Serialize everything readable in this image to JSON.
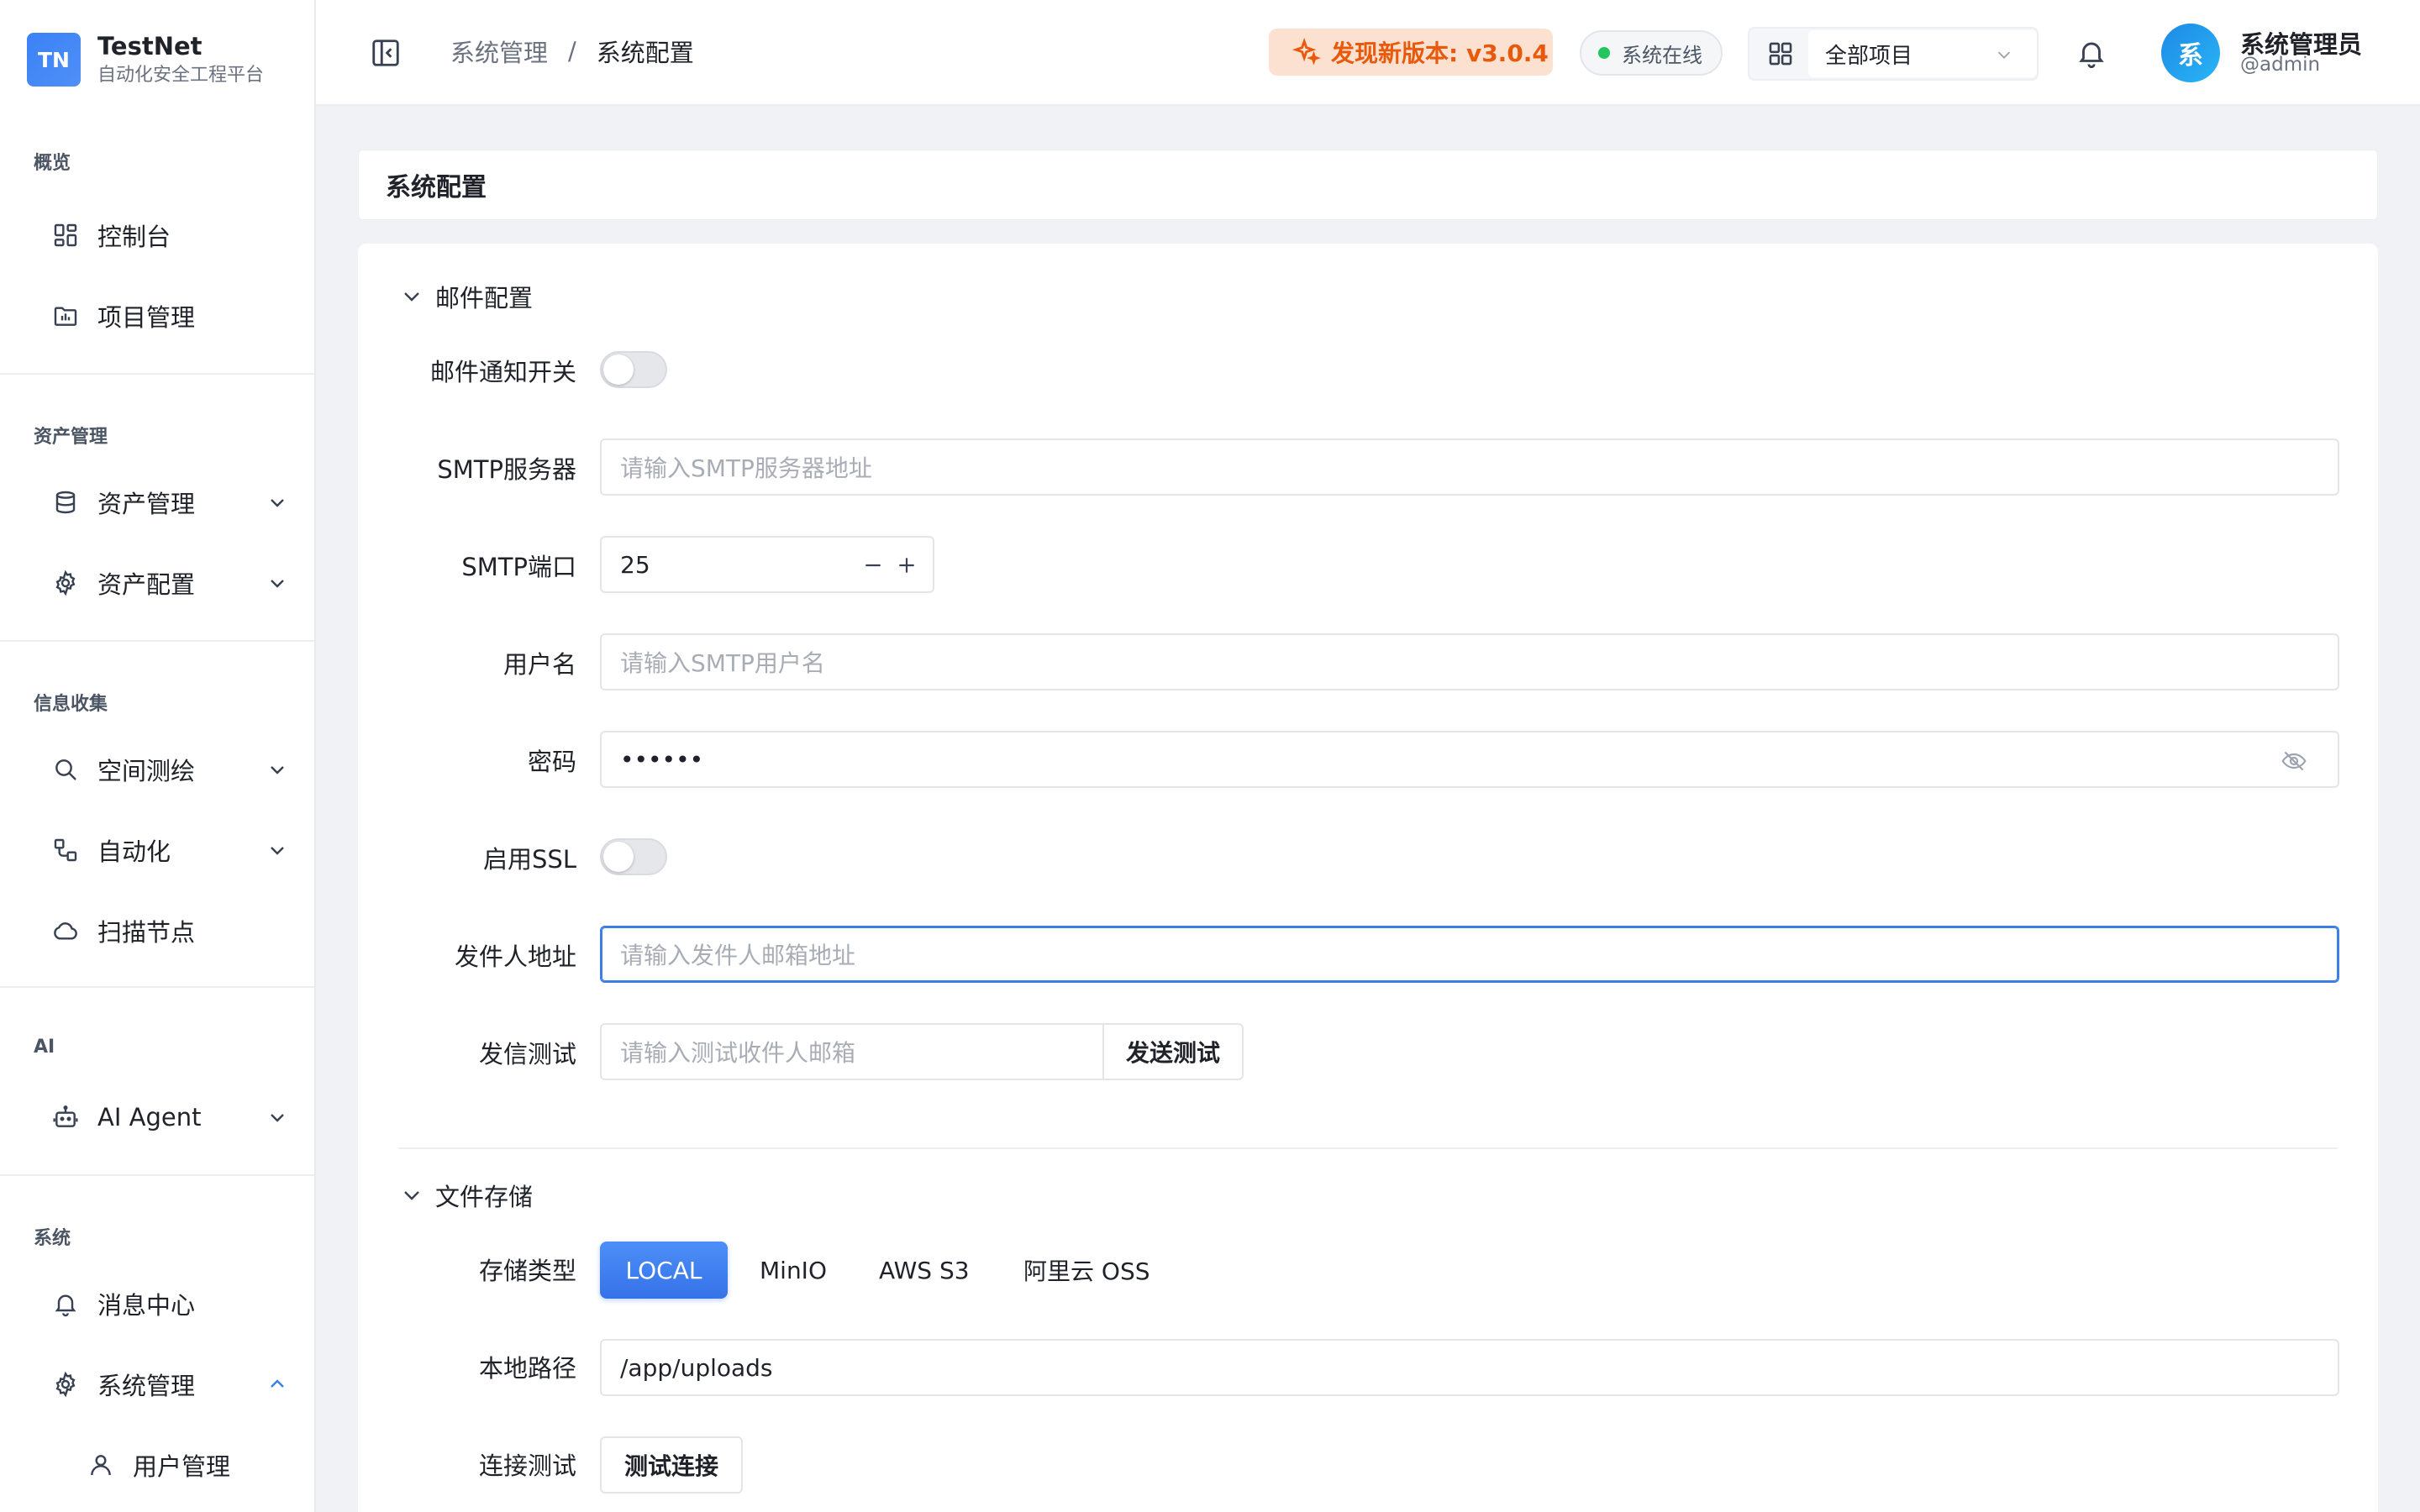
{
  "brand": {
    "logo": "TN",
    "name": "TestNet",
    "subtitle": "自动化安全工程平台"
  },
  "sidebar": {
    "sections": [
      {
        "title": "概览"
      },
      {
        "title": "资产管理"
      },
      {
        "title": "信息收集"
      },
      {
        "title": "AI"
      },
      {
        "title": "系统"
      }
    ],
    "items": [
      {
        "label": "控制台",
        "icon": "dashboard-icon"
      },
      {
        "label": "项目管理",
        "icon": "folder-chart-icon"
      },
      {
        "label": "资产管理",
        "icon": "database-icon",
        "expandable": true
      },
      {
        "label": "资产配置",
        "icon": "gear-icon",
        "expandable": true
      },
      {
        "label": "空间测绘",
        "icon": "search-icon",
        "expandable": true
      },
      {
        "label": "自动化",
        "icon": "workflow-icon",
        "expandable": true
      },
      {
        "label": "扫描节点",
        "icon": "cloud-icon"
      },
      {
        "label": "AI Agent",
        "icon": "robot-icon",
        "expandable": true
      },
      {
        "label": "消息中心",
        "icon": "bell-icon"
      },
      {
        "label": "系统管理",
        "icon": "gear-icon",
        "expanded": true
      },
      {
        "label": "用户管理",
        "icon": "user-icon"
      }
    ]
  },
  "header": {
    "breadcrumb": [
      "系统管理",
      "系统配置"
    ],
    "breadcrumb_sep": "/",
    "update_label": "发现新版本: v3.0.4",
    "status_label": "系统在线",
    "project_select": "全部项目",
    "user_name": "系统管理员",
    "user_handle": "@admin",
    "avatar_char": "系"
  },
  "page": {
    "title": "系统配置"
  },
  "mail": {
    "section_title": "邮件配置",
    "notify_label": "邮件通知开关",
    "notify_on": false,
    "smtp_server_label": "SMTP服务器",
    "smtp_server_placeholder": "请输入SMTP服务器地址",
    "smtp_port_label": "SMTP端口",
    "smtp_port_value": "25",
    "username_label": "用户名",
    "username_placeholder": "请输入SMTP用户名",
    "password_label": "密码",
    "password_value": "••••••",
    "ssl_label": "启用SSL",
    "ssl_on": false,
    "sender_label": "发件人地址",
    "sender_placeholder": "请输入发件人邮箱地址",
    "test_label": "发信测试",
    "test_placeholder": "请输入测试收件人邮箱",
    "test_button": "发送测试"
  },
  "storage": {
    "section_title": "文件存储",
    "type_label": "存储类型",
    "types": [
      "LOCAL",
      "MinIO",
      "AWS S3",
      "阿里云 OSS"
    ],
    "selected_type": "LOCAL",
    "path_label": "本地路径",
    "path_value": "/app/uploads",
    "conn_label": "连接测试",
    "conn_button": "测试连接"
  },
  "colors": {
    "accent": "#3b7fe6",
    "update_bg": "#fde1d0",
    "update_fg": "#e8590c",
    "online": "#22c55e"
  }
}
